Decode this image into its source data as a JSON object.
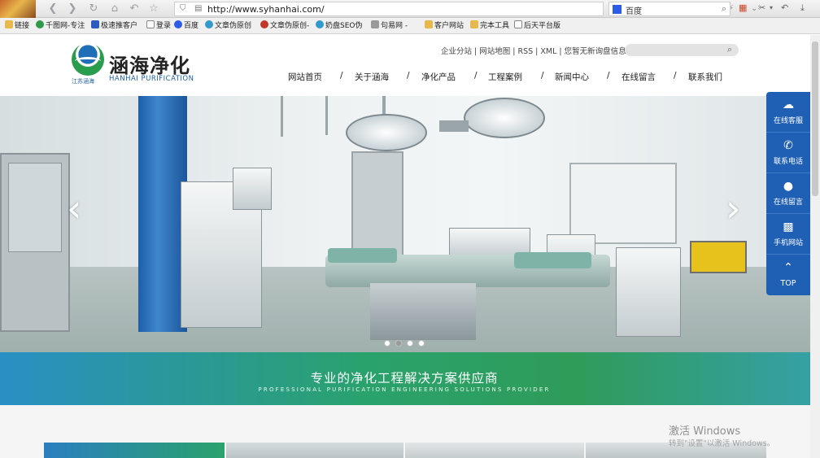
{
  "browser": {
    "url": "http://www.syhanhai.com/",
    "search_engine": "百度",
    "bookmarks": [
      {
        "label": "链接",
        "icon": "folder-icon"
      },
      {
        "label": "千图网-专注",
        "icon": "qiantu-icon"
      },
      {
        "label": "极速推客户",
        "icon": "jst-icon"
      },
      {
        "label": "登录",
        "icon": "document-icon"
      },
      {
        "label": "百度",
        "icon": "baidu-paw-icon"
      },
      {
        "label": "文章伪原创",
        "icon": "flower-icon"
      },
      {
        "label": "文章伪原创-",
        "icon": "red-circle-icon"
      },
      {
        "label": "奶盘SEO伪",
        "icon": "flower-icon"
      },
      {
        "label": "句易网 -",
        "icon": "gray-icon"
      },
      {
        "label": "客户网站",
        "icon": "folder-icon"
      },
      {
        "label": "完本工具",
        "icon": "folder-icon"
      },
      {
        "label": "后天平台版",
        "icon": "document-icon"
      }
    ]
  },
  "header": {
    "logo_title": "涵海净化",
    "logo_en": "HANHAI PURIFICATION",
    "logo_sub": "江苏涵海",
    "top_links": "企业分站 | 网站地图 | RSS | XML | 您暂无新询盘信息！",
    "search_placeholder": ""
  },
  "nav": {
    "items": [
      "网站首页",
      "关于涵海",
      "净化产品",
      "工程案例",
      "新闻中心",
      "在线留言",
      "联系我们"
    ],
    "separator": "/"
  },
  "banner": {
    "slides": 4,
    "active_slide": 1
  },
  "slogan": {
    "cn": "专业的净化工程解决方案供应商",
    "en": "PROFESSIONAL PURIFICATION ENGINEERING SOLUTIONS PROVIDER"
  },
  "side_tools": {
    "items": [
      {
        "label": "在线客服",
        "icon": "chat-bubble-icon"
      },
      {
        "label": "联系电话",
        "icon": "phone-icon"
      },
      {
        "label": "在线留言",
        "icon": "message-icon"
      },
      {
        "label": "手机网站",
        "icon": "qrcode-icon"
      }
    ],
    "top_label": "TOP"
  },
  "watermark": {
    "title": "激活 Windows",
    "subtitle": "转到\"设置\"以激活 Windows。"
  },
  "colors": {
    "accent_blue": "#1f60b5",
    "slogan_green": "#2aa26c",
    "logo_blue": "#1e5d9c"
  }
}
